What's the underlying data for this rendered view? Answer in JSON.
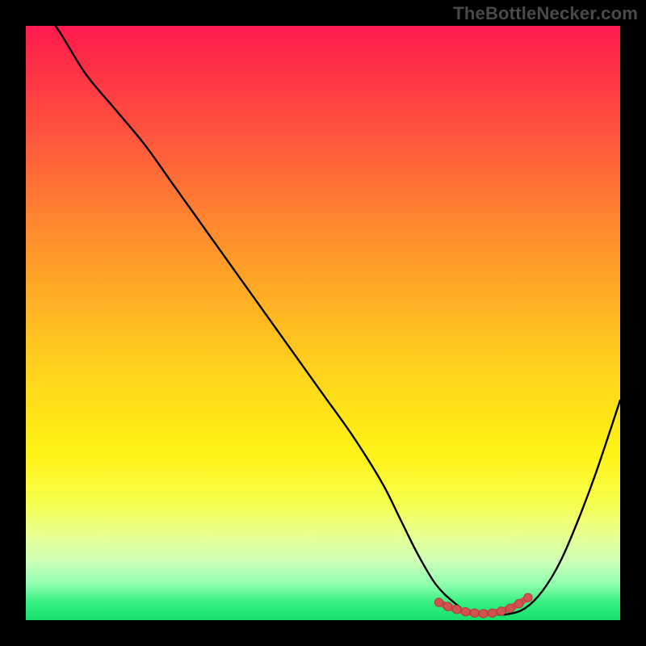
{
  "attribution": "TheBottleNecker.com",
  "colors": {
    "page_bg": "#000000",
    "gradient_top": "#ff1a4d",
    "gradient_bottom": "#14e06a",
    "curve": "#000000",
    "marker_fill": "#d1524f",
    "marker_stroke": "#b23c39",
    "attribution_text": "#4a4a4a"
  },
  "chart_data": {
    "type": "line",
    "title": "",
    "xlabel": "",
    "ylabel": "",
    "xlim": [
      0,
      100
    ],
    "ylim": [
      0,
      100
    ],
    "series": [
      {
        "name": "bottleneck-curve",
        "x": [
          0,
          5,
          10,
          15,
          20,
          25,
          30,
          35,
          40,
          45,
          50,
          55,
          60,
          63,
          66,
          69,
          72,
          75,
          78,
          81,
          84,
          87,
          90,
          93,
          96,
          100
        ],
        "y": [
          106,
          100,
          92,
          86,
          80,
          73,
          66,
          59,
          52,
          45,
          38,
          31,
          23,
          17,
          11,
          6,
          3,
          1,
          1,
          1,
          2,
          5,
          10,
          17,
          25,
          37
        ]
      }
    ],
    "markers": {
      "name": "optimal-range",
      "points": [
        {
          "x": 69.5,
          "y": 3.0
        },
        {
          "x": 71.0,
          "y": 2.3
        },
        {
          "x": 72.5,
          "y": 1.8
        },
        {
          "x": 74.0,
          "y": 1.4
        },
        {
          "x": 75.5,
          "y": 1.2
        },
        {
          "x": 77.0,
          "y": 1.1
        },
        {
          "x": 78.5,
          "y": 1.2
        },
        {
          "x": 80.0,
          "y": 1.5
        },
        {
          "x": 81.5,
          "y": 2.0
        },
        {
          "x": 83.0,
          "y": 2.8
        },
        {
          "x": 84.5,
          "y": 3.8
        }
      ]
    }
  }
}
